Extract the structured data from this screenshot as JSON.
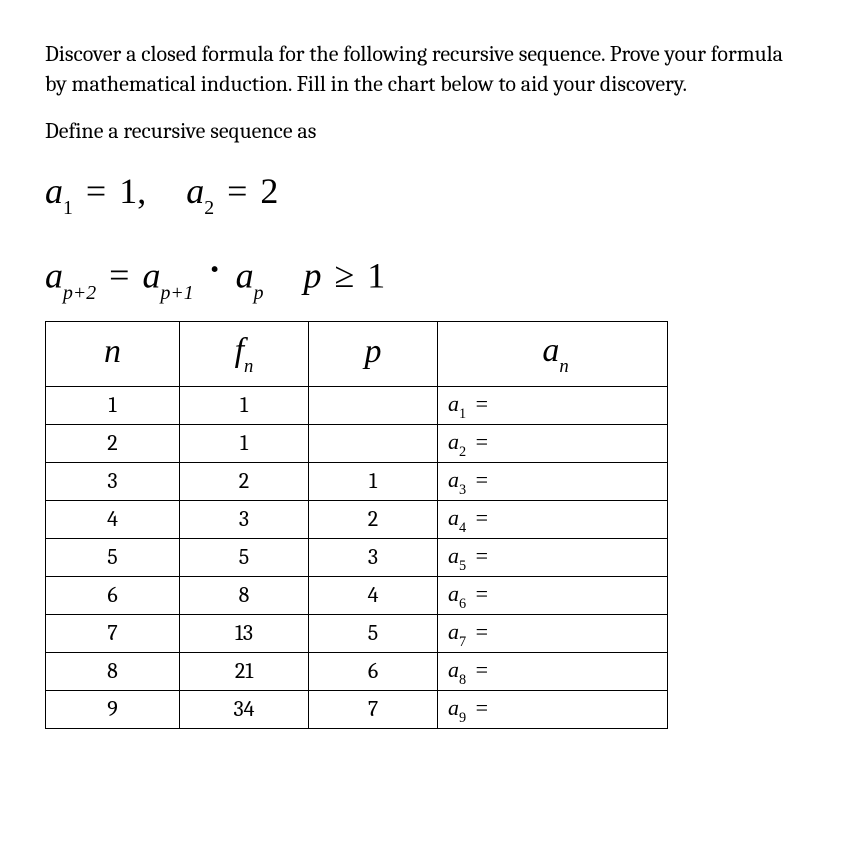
{
  "problem": {
    "text1": "Discover a closed formula for the following recursive sequence. Prove your formula by mathematical induction. Fill in the chart below to aid your discovery.",
    "text2": "Define a recursive sequence as"
  },
  "equations": {
    "line1": {
      "a": "a",
      "s1": "1",
      "eq1": "=",
      "v1": "1",
      "comma": ",",
      "a2": "a",
      "s2": "2",
      "eq2": "=",
      "v2": "2"
    },
    "line2": {
      "a": "a",
      "s1": "p+2",
      "eq": "=",
      "a2": "a",
      "s2": "p+1",
      "a3": "a",
      "s3": "p",
      "cond_p": "p",
      "cond_op": "≥",
      "cond_v": "1"
    }
  },
  "headers": {
    "n": "n",
    "fn_f": "f",
    "fn_sub": "n",
    "p": "p",
    "an_a": "a",
    "an_sub": "n"
  },
  "rows": [
    {
      "n": "1",
      "fn": "1",
      "p": "",
      "a_sub": "1"
    },
    {
      "n": "2",
      "fn": "1",
      "p": "",
      "a_sub": "2"
    },
    {
      "n": "3",
      "fn": "2",
      "p": "1",
      "a_sub": "3"
    },
    {
      "n": "4",
      "fn": "3",
      "p": "2",
      "a_sub": "4"
    },
    {
      "n": "5",
      "fn": "5",
      "p": "3",
      "a_sub": "5"
    },
    {
      "n": "6",
      "fn": "8",
      "p": "4",
      "a_sub": "6"
    },
    {
      "n": "7",
      "fn": "13",
      "p": "5",
      "a_sub": "7"
    },
    {
      "n": "8",
      "fn": "21",
      "p": "6",
      "a_sub": "8"
    },
    {
      "n": "9",
      "fn": "34",
      "p": "7",
      "a_sub": "9"
    }
  ]
}
